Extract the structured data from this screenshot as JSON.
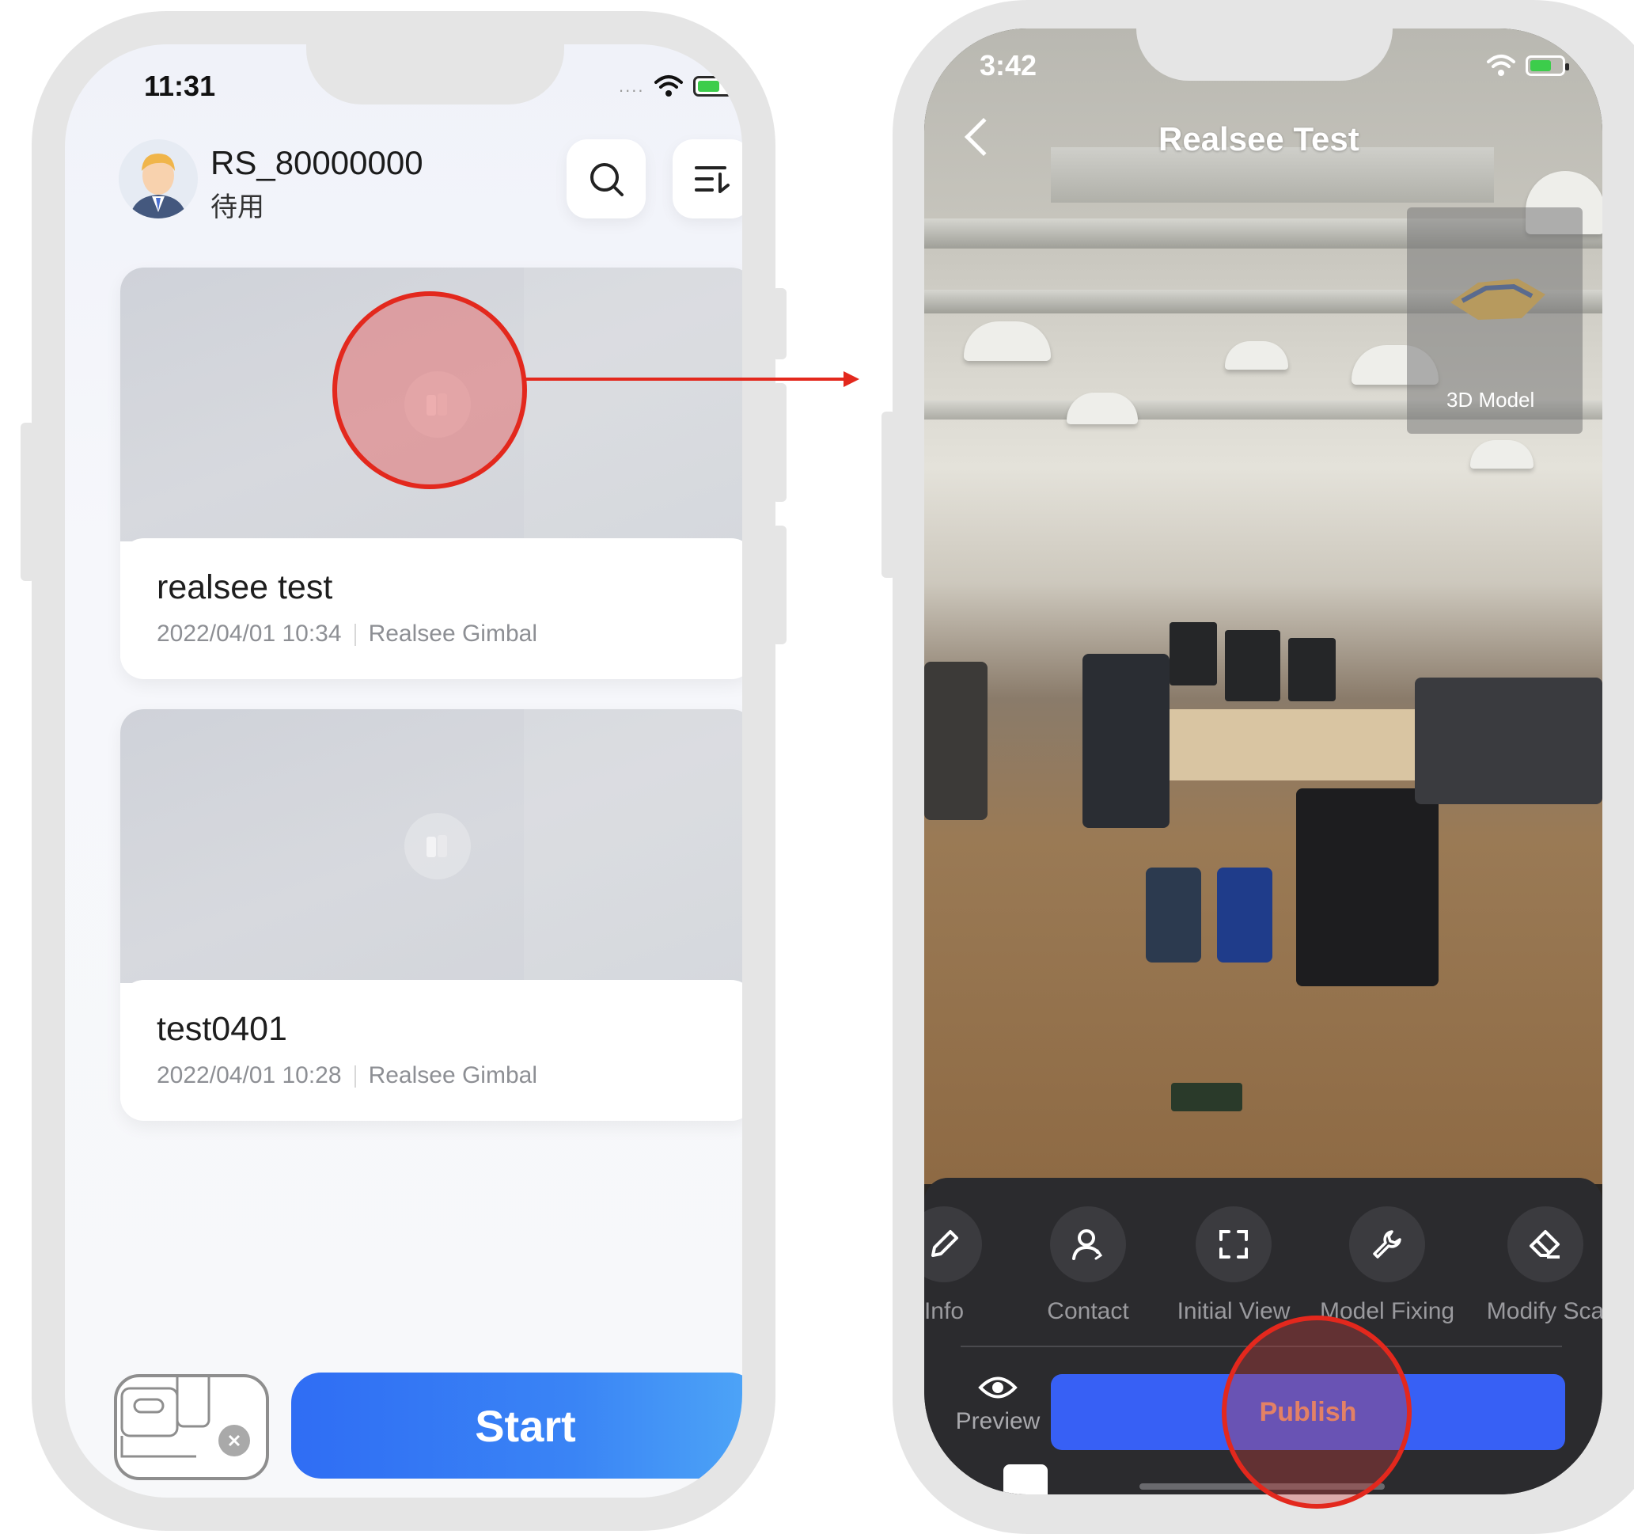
{
  "left_phone": {
    "status_time": "11:31",
    "user": {
      "name": "RS_80000000",
      "status": "待用"
    },
    "header_icons": [
      "search-icon",
      "sort-icon"
    ],
    "projects": [
      {
        "title": "realsee test",
        "date": "2022/04/01 10:34",
        "device": "Realsee Gimbal"
      },
      {
        "title": "test0401",
        "date": "2022/04/01 10:28",
        "device": "Realsee Gimbal"
      }
    ],
    "start_label": "Start"
  },
  "right_phone": {
    "status_time": "3:42",
    "title": "Realsee Test",
    "model_label": "3D Model",
    "tools": [
      {
        "label": "Info",
        "icon": "pencil-icon"
      },
      {
        "label": "Contact",
        "icon": "person-icon"
      },
      {
        "label": "Initial View",
        "icon": "frame-icon"
      },
      {
        "label": "Model Fixing",
        "icon": "wrench-icon"
      },
      {
        "label": "Modify Sca",
        "icon": "eraser-icon"
      }
    ],
    "preview_label": "Preview",
    "publish_label": "Publish"
  },
  "colors": {
    "accent_blue": "#3760f5",
    "annotation_red": "#e3281d",
    "publish_text": "#f2a77c"
  }
}
